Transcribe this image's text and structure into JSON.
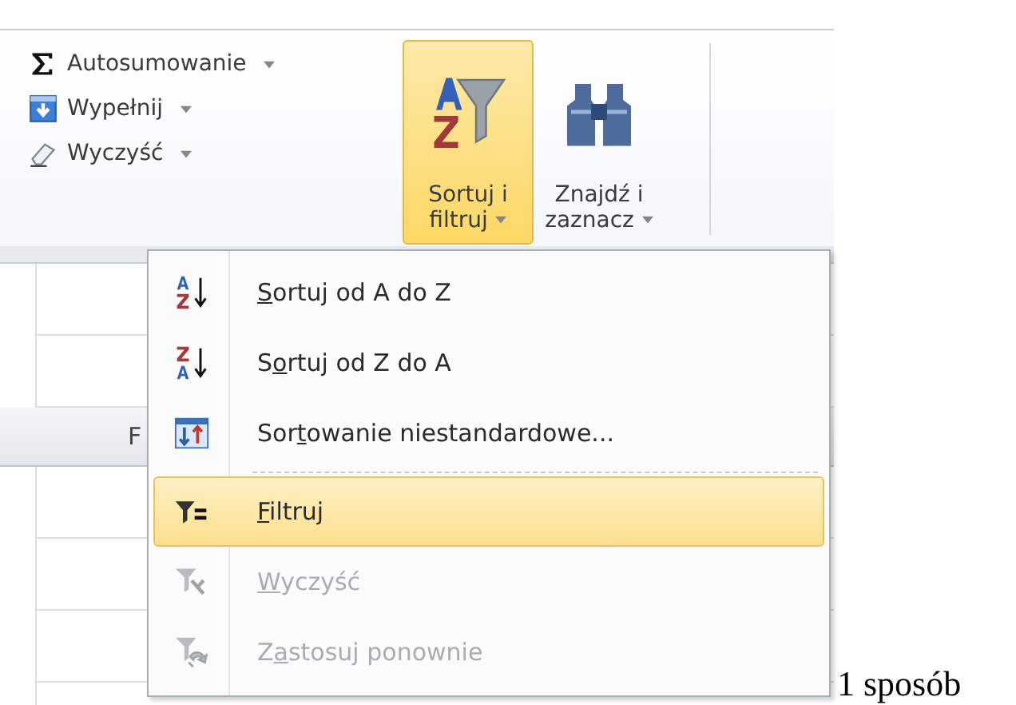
{
  "ribbon": {
    "small_buttons": [
      {
        "label": "Autosumowanie"
      },
      {
        "label": "Wypełnij"
      },
      {
        "label": "Wyczyść"
      }
    ],
    "large_buttons": [
      {
        "line1": "Sortuj i",
        "line2": "filtruj",
        "selected": true
      },
      {
        "line1": "Znajdź i",
        "line2": "zaznacz",
        "selected": false
      }
    ]
  },
  "sheet": {
    "column_header": "F"
  },
  "menu": {
    "items": [
      {
        "kind": "item",
        "label_parts": [
          {
            "text": "S",
            "underlined": true
          },
          {
            "text": "ortuj od A do Z",
            "underlined": false
          }
        ],
        "disabled": false,
        "selected": false
      },
      {
        "kind": "item",
        "label_parts": [
          {
            "text": "S",
            "underlined": false
          },
          {
            "text": "o",
            "underlined": true
          },
          {
            "text": "rtuj od Z do A",
            "underlined": false
          }
        ],
        "disabled": false,
        "selected": false
      },
      {
        "kind": "item",
        "label_parts": [
          {
            "text": "Sor",
            "underlined": false
          },
          {
            "text": "t",
            "underlined": true
          },
          {
            "text": "owanie niestandardowe...",
            "underlined": false
          }
        ],
        "disabled": false,
        "selected": false
      },
      {
        "kind": "separator"
      },
      {
        "kind": "item",
        "label_parts": [
          {
            "text": "F",
            "underlined": true
          },
          {
            "text": "iltruj",
            "underlined": false
          }
        ],
        "disabled": false,
        "selected": true
      },
      {
        "kind": "item",
        "label_parts": [
          {
            "text": "W",
            "underlined": true
          },
          {
            "text": "yczyść",
            "underlined": false
          }
        ],
        "disabled": true,
        "selected": false
      },
      {
        "kind": "item",
        "label_parts": [
          {
            "text": "Z",
            "underlined": false
          },
          {
            "text": "a",
            "underlined": true
          },
          {
            "text": "stosuj ponownie",
            "underlined": false
          }
        ],
        "disabled": true,
        "selected": false
      }
    ]
  },
  "caption": "1 sposób"
}
